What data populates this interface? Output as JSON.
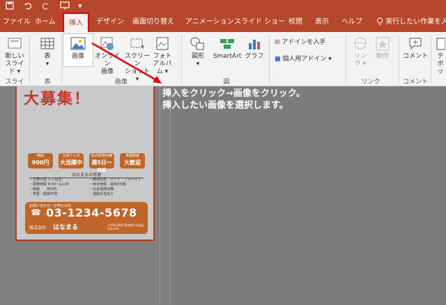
{
  "quick_access": {
    "save_icon": "save-icon",
    "undo_icon": "undo-icon",
    "redo_icon": "redo-icon",
    "start_icon": "start-presentation-icon",
    "more": "▾"
  },
  "tabs": [
    {
      "label": "ファイル"
    },
    {
      "label": "ホーム"
    },
    {
      "label": "挿入"
    },
    {
      "label": "デザイン"
    },
    {
      "label": "画面切り替え"
    },
    {
      "label": "アニメーション"
    },
    {
      "label": "スライド ショー"
    },
    {
      "label": "校閲"
    },
    {
      "label": "表示"
    },
    {
      "label": "ヘルプ"
    }
  ],
  "tell_me": "実行したい作業を入",
  "ribbon": {
    "new_slide": {
      "line1": "新しい",
      "line2": "スライド ▾"
    },
    "table": {
      "label": "表",
      "caret": "▾"
    },
    "image": {
      "label": "画像"
    },
    "online_image": {
      "line1": "オンライン",
      "line2": "画像"
    },
    "screenshot": {
      "line1": "スクリーン",
      "line2": "ショット ▾"
    },
    "photo_album": {
      "line1": "フォト",
      "line2": "アルバム ▾"
    },
    "shape": {
      "line1": "図形",
      "line2": "▾"
    },
    "smartart": {
      "label": "SmartArt"
    },
    "graph": {
      "label": "グラフ"
    },
    "get_addins": {
      "label": "アドインを入手"
    },
    "my_addins": {
      "label": "個人用アドイン",
      "caret": "▾"
    },
    "link": {
      "line1": "リン",
      "line2": "ク ▾"
    },
    "action": {
      "label": "動作"
    },
    "comment": {
      "label": "コメント"
    },
    "text": {
      "line1": "テ",
      "line2": "ボッ"
    },
    "groups": {
      "slide": "スライド",
      "table": "表",
      "image": "画像",
      "figure": "図",
      "link": "リンク",
      "comment": "コメント"
    }
  },
  "flyer": {
    "headline": "大募集！",
    "badges": [
      {
        "small": "時給",
        "big": "900円"
      },
      {
        "small": "主婦さんが",
        "big": "大活躍中"
      },
      {
        "small": "社内研修完備",
        "big": "週5日〜OK"
      },
      {
        "small": "未経験者",
        "big": "大歓迎"
      }
    ],
    "benefit_title": "はなまるの待遇",
    "conditions_left": [
      "・仕事内容 レジ担当",
      "・勤務時間 8:30〜12:00",
      "・時給　　900円",
      "・学歴・経験不問"
    ],
    "conditions_right": [
      "・雇用形態　パート・アルバイト",
      "・休日休暇　週休3日制",
      "・社会保険完備",
      "・通勤手当あり"
    ],
    "contact_title": "お問い合わせ・お申込み先",
    "phone": "03-1234-5678",
    "company_label": "株式会社",
    "company_name": "はなまる",
    "address": "〒100-0000 東京都千代田区 333-451"
  },
  "instruction": {
    "line1": "挿入をクリック→画像をクリック。",
    "line2": "挿入したい画像を選択します。"
  },
  "colors": {
    "accent": "#b7472a",
    "annotation_arrow": "#e8000b"
  }
}
